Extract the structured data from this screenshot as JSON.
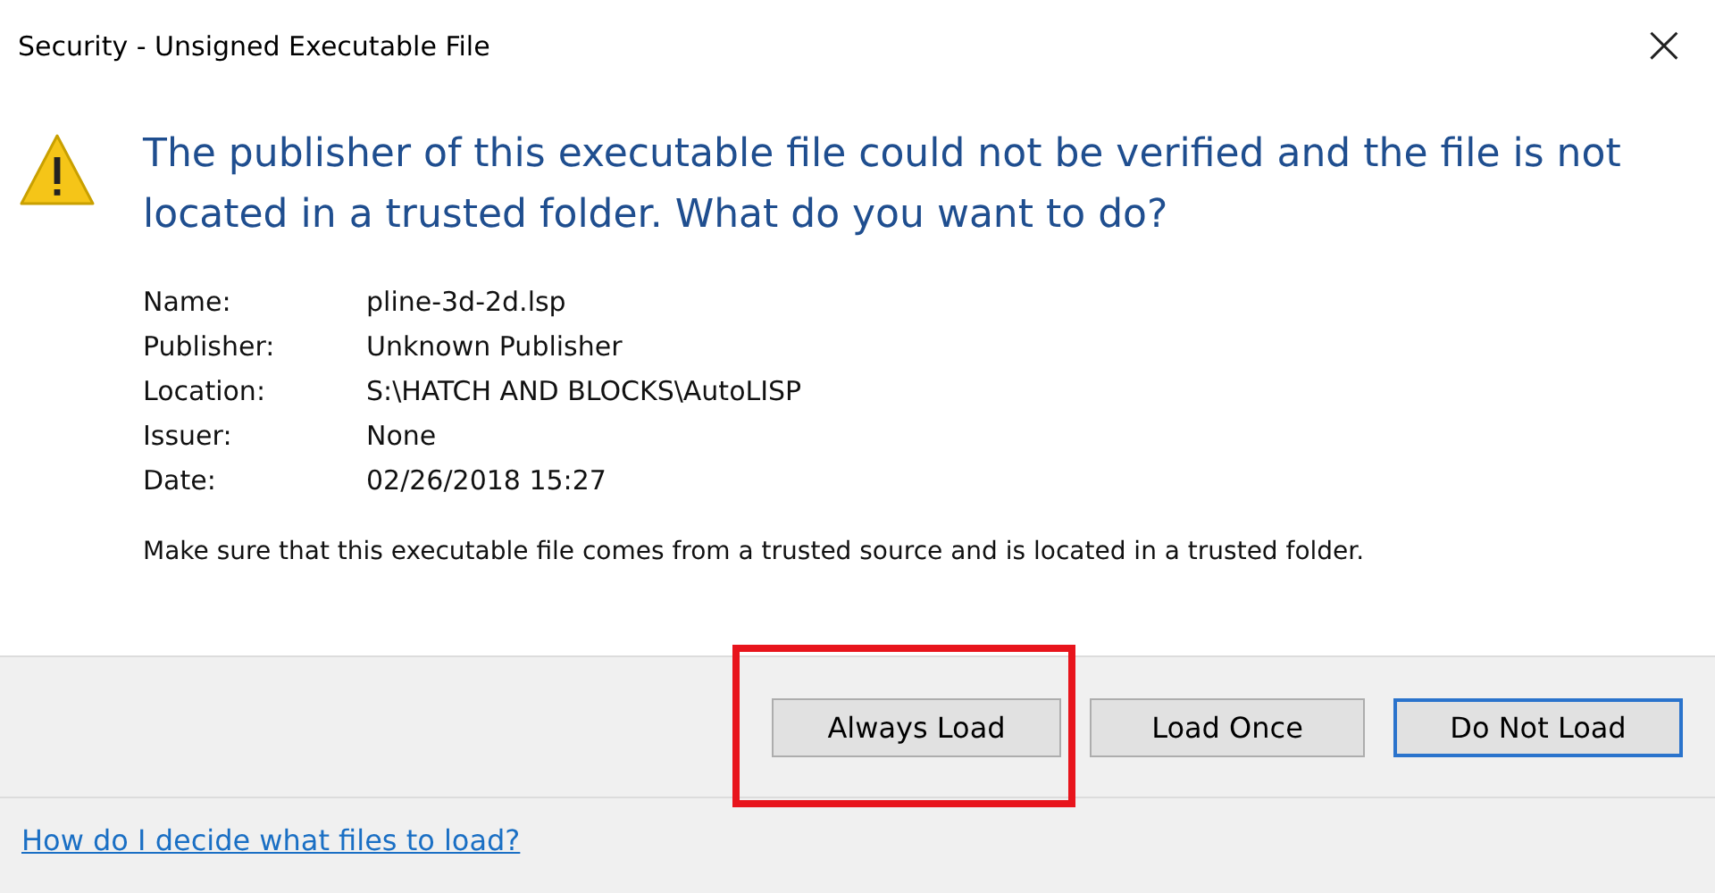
{
  "window": {
    "title": "Security - Unsigned Executable File",
    "close": "×"
  },
  "message": "The publisher of this executable file could not be verified and the file is not located in a trusted folder. What do you want to do?",
  "details": [
    {
      "label": "Name:",
      "value": "pline-3d-2d.lsp"
    },
    {
      "label": "Publisher:",
      "value": "Unknown Publisher"
    },
    {
      "label": "Location:",
      "value": "S:\\HATCH AND BLOCKS\\AutoLISP"
    },
    {
      "label": "Issuer:",
      "value": "None"
    },
    {
      "label": "Date:",
      "value": "02/26/2018  15:27"
    }
  ],
  "note": "Make sure that this executable file comes from a trusted source and is located in a trusted folder.",
  "buttons": [
    {
      "label": "Always Load",
      "default": false,
      "highlighted": true
    },
    {
      "label": "Load Once",
      "default": false,
      "highlighted": false
    },
    {
      "label": "Do Not Load",
      "default": true,
      "highlighted": false
    }
  ],
  "help_link": "How do I decide what files to load?"
}
